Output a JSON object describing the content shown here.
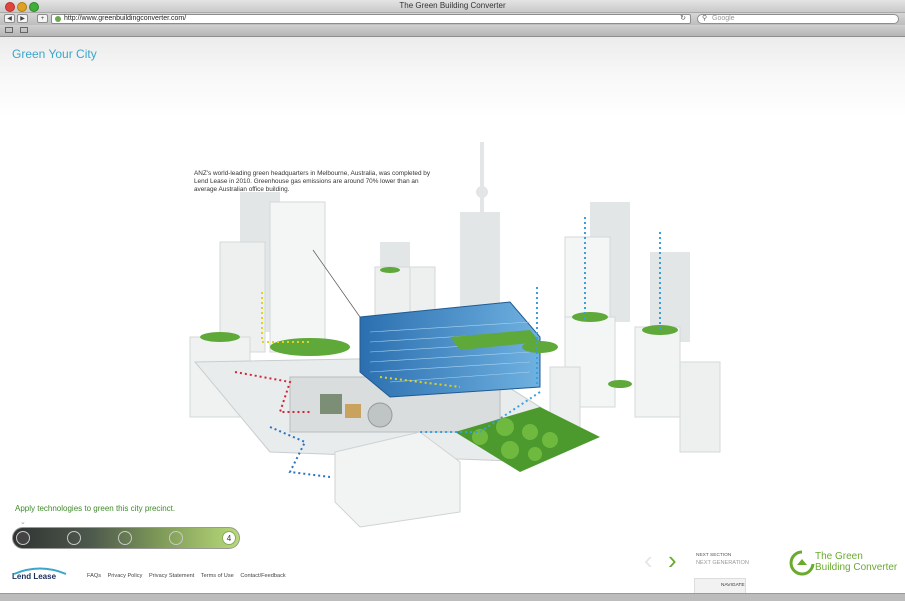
{
  "window": {
    "title": "The Green Building Converter"
  },
  "toolbar": {
    "back_label": "◀",
    "forward_label": "▶",
    "add_label": "+",
    "url": "http://www.greenbuildingconverter.com/",
    "reload_label": "↻",
    "search_placeholder": "Google",
    "search_icon": "⚲"
  },
  "page": {
    "title": "Green Your City",
    "caption": "ANZ's world-leading green headquarters in Melbourne, Australia, was completed by Lend Lease in 2010. Greenhouse gas emissions are around 70% lower than an average Australian office building.",
    "prompt": "Apply technologies to green this city precinct.",
    "chevron": "⌄",
    "progress": {
      "current_step": "4",
      "total_steps": 5,
      "level": 1.0
    }
  },
  "footer": {
    "logo_text": "Lend Lease",
    "links": [
      "FAQs",
      "Privacy Policy",
      "Privacy Statement",
      "Terms of Use",
      "Contact/Feedback"
    ],
    "prev_arrow": "‹",
    "next_arrow": "›",
    "next_section_label": "NEXT SECTION",
    "next_section_value": "NEXT GENERATION",
    "navigate_label": "NAVIGATE",
    "brand_line1": "The Green",
    "brand_line2": "Building Converter"
  },
  "colors": {
    "accent_blue": "#3aa6cc",
    "accent_green": "#6aab2e",
    "dark": "#1a2e5c"
  }
}
